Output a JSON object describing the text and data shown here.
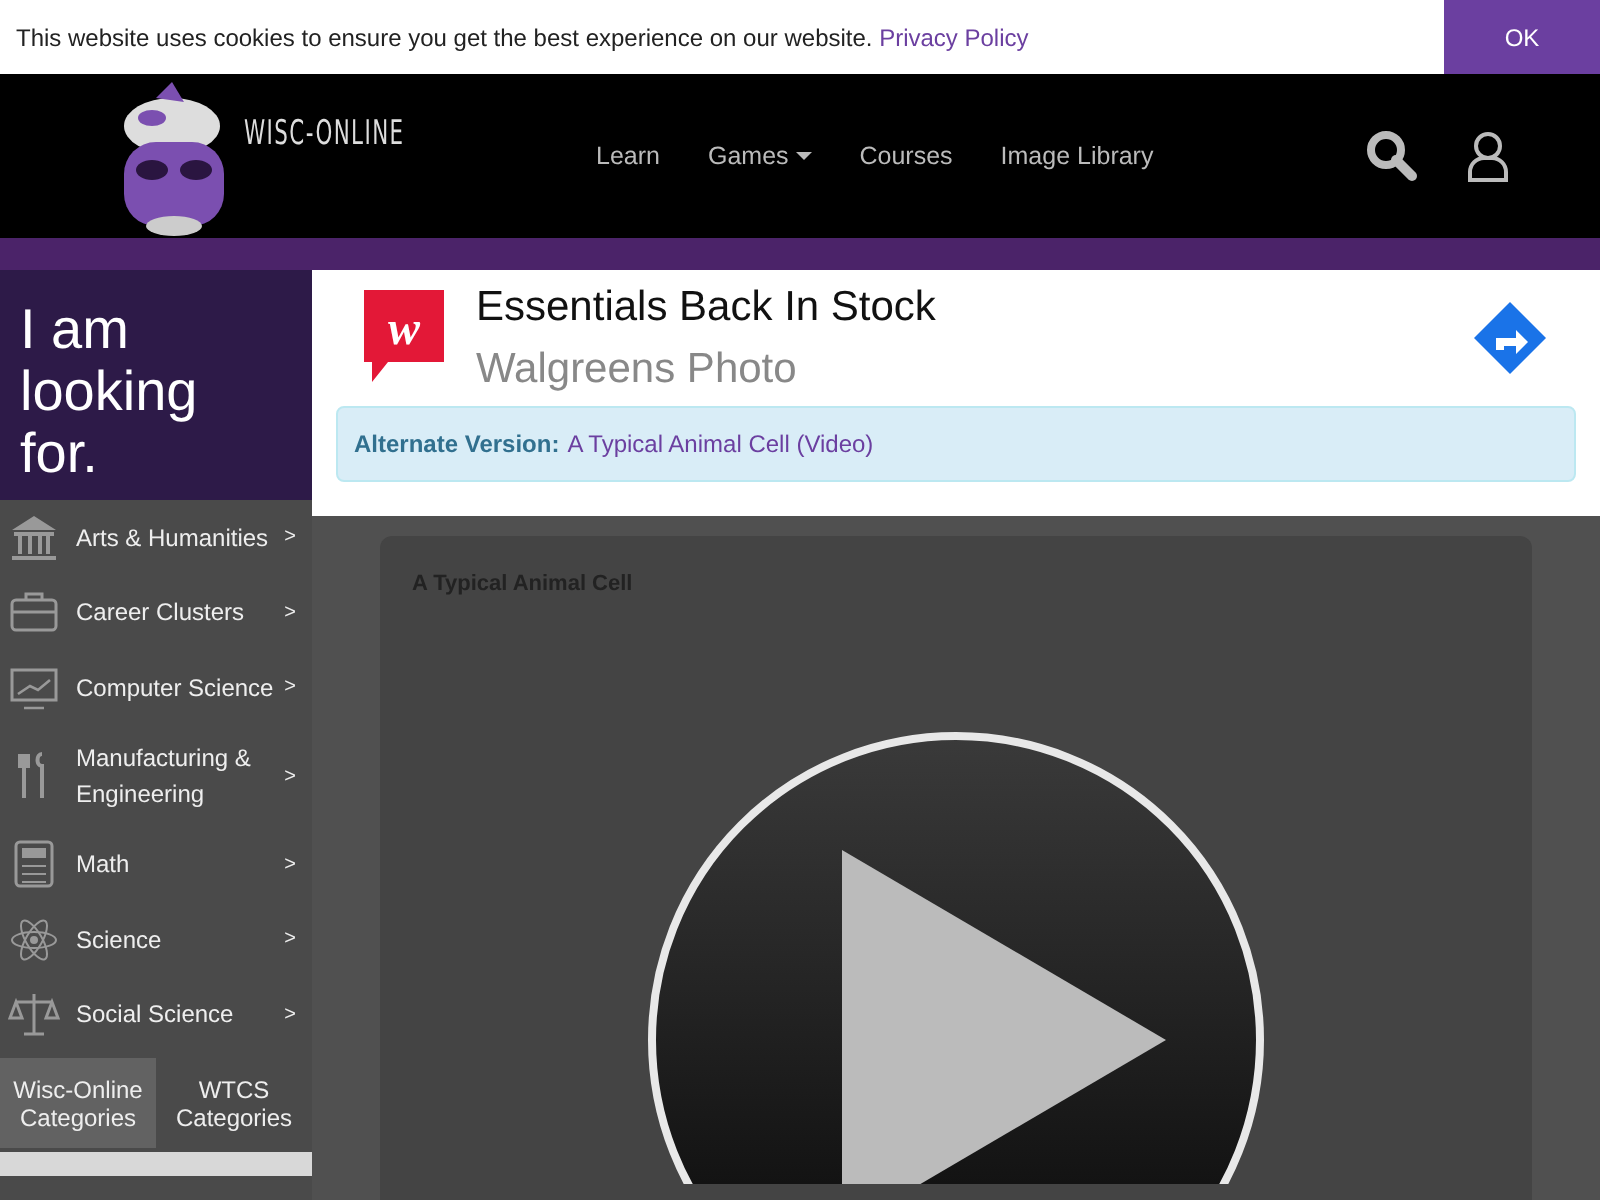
{
  "cookie_bar": {
    "message": "This website uses cookies to ensure you get the best experience on our website.",
    "link": "Privacy Policy",
    "button": "OK"
  },
  "header": {
    "logo_text": "WISC-ONLINE",
    "nav": [
      {
        "label": "Learn",
        "dropdown": false
      },
      {
        "label": "Games",
        "dropdown": true
      },
      {
        "label": "Courses",
        "dropdown": false
      },
      {
        "label": "Image Library",
        "dropdown": false
      }
    ]
  },
  "sidebar": {
    "heading": "I am looking for.",
    "items": [
      {
        "kind": "building",
        "label": "Arts & Humanities",
        "arrow": ">"
      },
      {
        "kind": "briefcase",
        "label": "Career Clusters",
        "arrow": ">"
      },
      {
        "kind": "monitor",
        "label": "Computer Science",
        "arrow": ">"
      },
      {
        "kind": "tools",
        "label": "Manufacturing & Engineering",
        "arrow": ">"
      },
      {
        "kind": "calculator",
        "label": "Math",
        "arrow": ">"
      },
      {
        "kind": "atom",
        "label": "Science",
        "arrow": ">"
      },
      {
        "kind": "scales",
        "label": "Social Science",
        "arrow": ">"
      }
    ],
    "tabs": [
      {
        "label": "Wisc-Online Categories",
        "selected": true
      },
      {
        "label": "WTCS Categories",
        "selected": false
      }
    ]
  },
  "ad": {
    "logo_letter": "w",
    "headline": "Essentials Back In Stock",
    "advertiser": "Walgreens Photo"
  },
  "alternate": {
    "label": "Alternate Version:",
    "link": "A Typical Animal Cell (Video)"
  },
  "video": {
    "title": "A Typical Animal Cell"
  }
}
